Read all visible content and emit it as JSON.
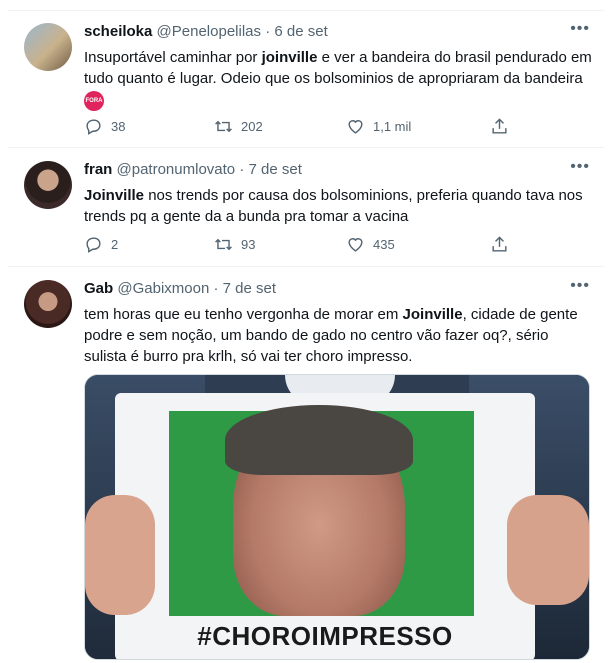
{
  "tweets": [
    {
      "name": "scheiloka",
      "handle": "@Penelopelilas",
      "date": "6 de set",
      "text_before": "Insuportável caminhar por ",
      "text_bold": "joinville",
      "text_after": " e ver a bandeira do brasil pendurado em tudo quanto é lugar. Odeio que os bolsominios de apropriaram da bandeira",
      "emoji": "FORA",
      "replies": "38",
      "retweets": "202",
      "likes": "1,1 mil"
    },
    {
      "name": "fran",
      "handle": "@patronumlovato",
      "date": "7 de set",
      "text_bold": "Joinville",
      "text_after": " nos trends por causa dos bolsominions, preferia quando tava nos trends pq a gente da a bunda pra tomar a vacina",
      "replies": "2",
      "retweets": "93",
      "likes": "435"
    },
    {
      "name": "Gab",
      "handle": "@Gabixmoon",
      "date": "7 de set",
      "text_before": "tem horas que eu tenho vergonha de morar em ",
      "text_bold": "Joinville",
      "text_after": ", cidade de gente podre e sem noção, um bando de gado no centro vão fazer oq?, sério sulista é burro pra krlh, só vai ter choro impresso.",
      "image_caption": "#CHOROIMPRESSO"
    }
  ],
  "separator": "·",
  "more": "•••",
  "icons": {
    "reply": "reply-icon",
    "retweet": "retweet-icon",
    "like": "heart-icon",
    "share": "share-icon"
  },
  "colors": {
    "text": "#0f1419",
    "secondary": "#536471",
    "border": "#eff3f4"
  }
}
